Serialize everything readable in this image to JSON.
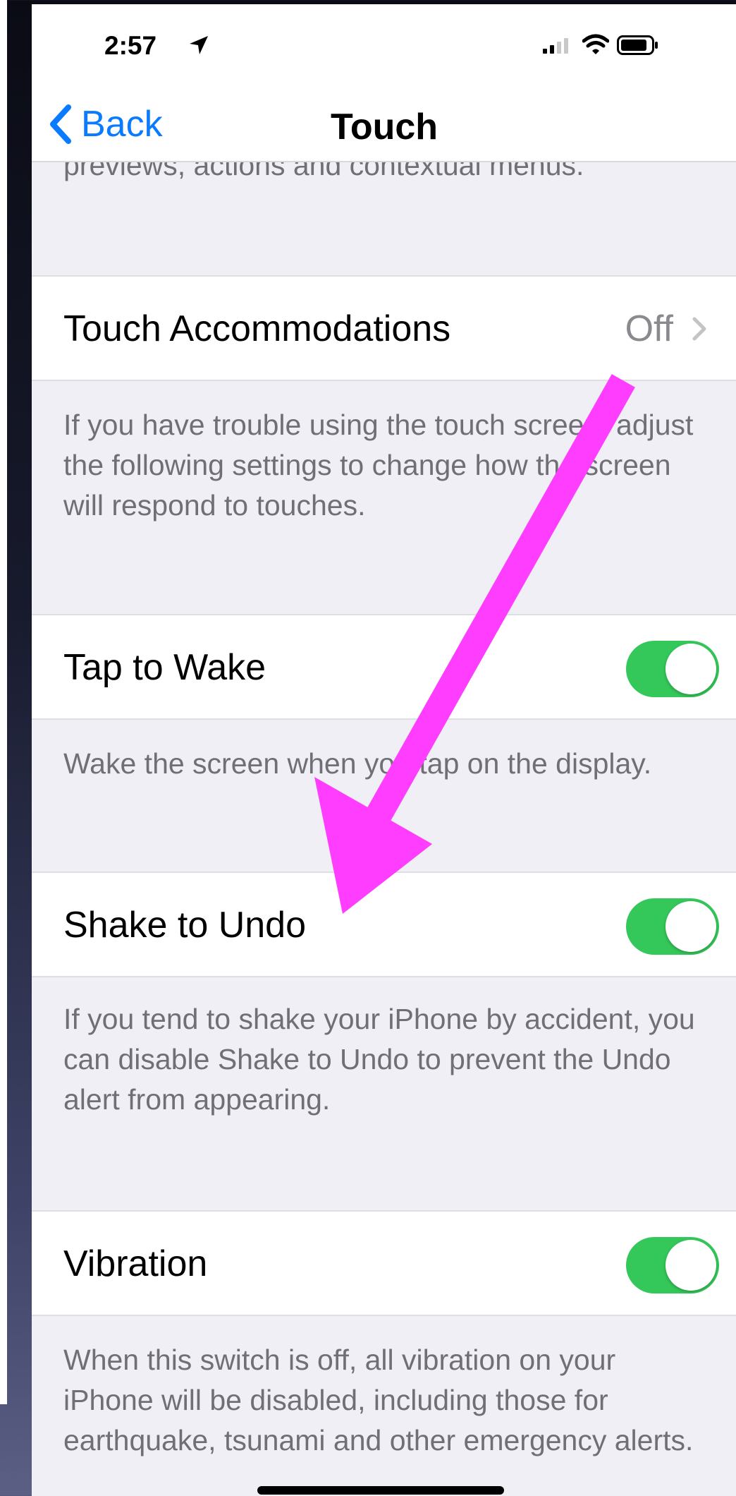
{
  "status_bar": {
    "time": "2:57",
    "icons": [
      "location-arrow-icon",
      "cellular-signal-icon",
      "wifi-icon",
      "battery-icon"
    ]
  },
  "nav": {
    "back_label": "Back",
    "title": "Touch"
  },
  "sections": {
    "top_footer": "previews, actions and contextual menus.",
    "touch_accommodations": {
      "label": "Touch Accommodations",
      "value": "Off",
      "footer": "If you have trouble using the touch screen, adjust the following settings to change how the screen will respond to touches."
    },
    "tap_to_wake": {
      "label": "Tap to Wake",
      "on": true,
      "footer": "Wake the screen when you tap on the display."
    },
    "shake_to_undo": {
      "label": "Shake to Undo",
      "on": true,
      "footer": "If you tend to shake your iPhone by accident, you can disable Shake to Undo to prevent the Undo alert from appearing."
    },
    "vibration": {
      "label": "Vibration",
      "on": true,
      "footer": "When this switch is off, all vibration on your iPhone will be disabled, including those for earthquake, tsunami and other emergency alerts."
    }
  },
  "colors": {
    "accent_blue": "#0a7aff",
    "toggle_on": "#34c759",
    "annotation_arrow": "#ff3dff"
  }
}
